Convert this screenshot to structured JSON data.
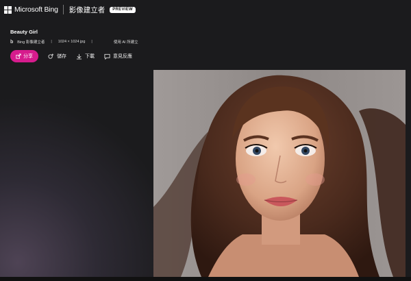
{
  "header": {
    "brand": "Microsoft Bing",
    "product": "影像建立者",
    "badge": "PREVIEW"
  },
  "image_info": {
    "title": "Beauty Girl",
    "source_icon": "b",
    "source": "Bing 影像建立者",
    "size": "1024 × 1024 jpg",
    "separator": "|",
    "ai_note": "使用 AI 所建立"
  },
  "actions": {
    "share": "分享",
    "save": "儲存",
    "download": "下載",
    "feedback": "意見反應"
  },
  "icons": [
    "microsoft-logo-icon",
    "bing-icon",
    "share-icon",
    "save-icon",
    "download-icon",
    "feedback-icon"
  ],
  "colors": {
    "accent": "#d61c8d",
    "background": "#1b1b1d"
  }
}
